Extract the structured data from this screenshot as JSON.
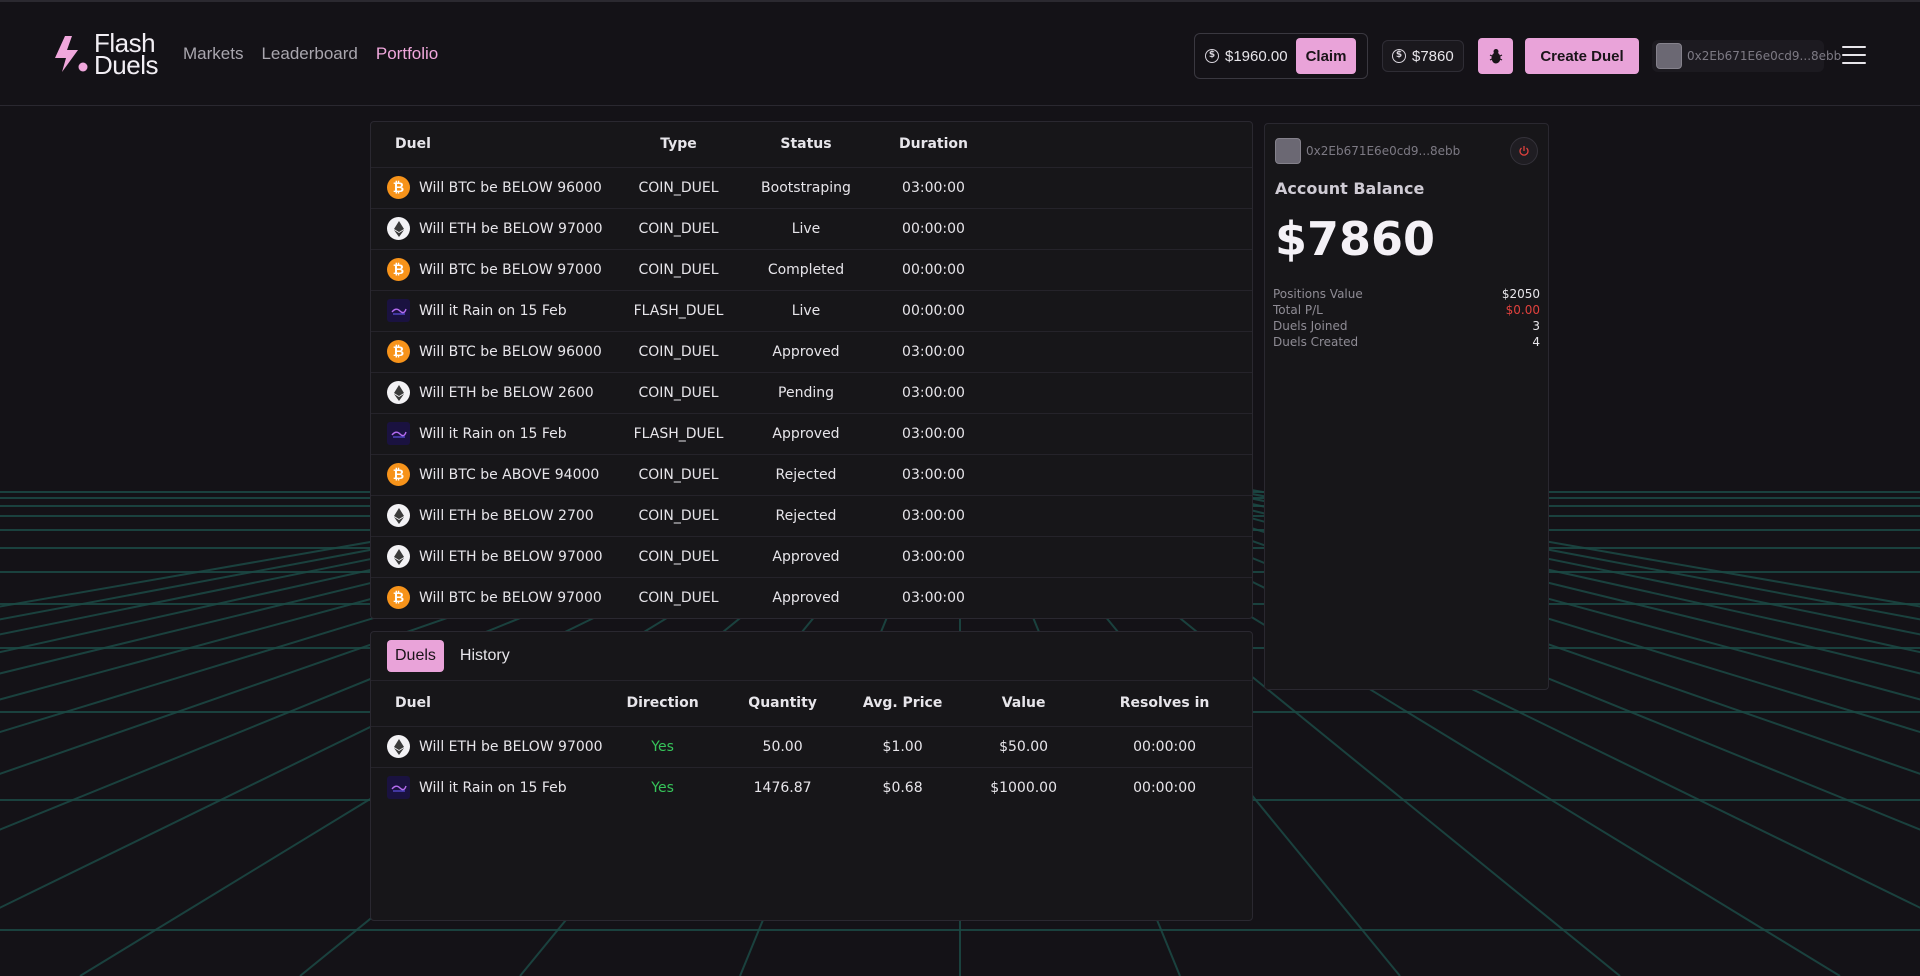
{
  "brand": {
    "line1": "Flash",
    "line2": "Duels"
  },
  "nav": [
    {
      "label": "Markets",
      "active": false
    },
    {
      "label": "Leaderboard",
      "active": false
    },
    {
      "label": "Portfolio",
      "active": true
    }
  ],
  "header": {
    "claimable_amount": "$1960.00",
    "claim_label": "Claim",
    "balance": "$7860",
    "create_duel_label": "Create Duel",
    "wallet_address": "0x2Eb671E6e0cd9...8ebb"
  },
  "duels_table": {
    "headers": [
      "Duel",
      "Type",
      "Status",
      "Duration"
    ],
    "rows": [
      {
        "icon": "btc",
        "title": "Will BTC be BELOW 96000",
        "type": "COIN_DUEL",
        "status": "Bootstraping",
        "duration": "03:00:00"
      },
      {
        "icon": "eth",
        "title": "Will ETH be BELOW 97000",
        "type": "COIN_DUEL",
        "status": "Live",
        "duration": "00:00:00"
      },
      {
        "icon": "btc",
        "title": "Will BTC be BELOW 97000",
        "type": "COIN_DUEL",
        "status": "Completed",
        "duration": "00:00:00"
      },
      {
        "icon": "rain",
        "title": "Will it Rain on 15 Feb",
        "type": "FLASH_DUEL",
        "status": "Live",
        "duration": "00:00:00"
      },
      {
        "icon": "btc",
        "title": "Will BTC be BELOW 96000",
        "type": "COIN_DUEL",
        "status": "Approved",
        "duration": "03:00:00"
      },
      {
        "icon": "eth",
        "title": "Will ETH be BELOW 2600",
        "type": "COIN_DUEL",
        "status": "Pending",
        "duration": "03:00:00"
      },
      {
        "icon": "rain",
        "title": "Will it Rain on 15 Feb",
        "type": "FLASH_DUEL",
        "status": "Approved",
        "duration": "03:00:00"
      },
      {
        "icon": "btc",
        "title": "Will BTC be ABOVE 94000",
        "type": "COIN_DUEL",
        "status": "Rejected",
        "duration": "03:00:00"
      },
      {
        "icon": "eth",
        "title": "Will ETH be BELOW 2700",
        "type": "COIN_DUEL",
        "status": "Rejected",
        "duration": "03:00:00"
      },
      {
        "icon": "eth",
        "title": "Will ETH be BELOW 97000",
        "type": "COIN_DUEL",
        "status": "Approved",
        "duration": "03:00:00"
      },
      {
        "icon": "btc",
        "title": "Will BTC be BELOW 97000",
        "type": "COIN_DUEL",
        "status": "Approved",
        "duration": "03:00:00"
      }
    ]
  },
  "positions": {
    "tabs": [
      {
        "label": "Duels",
        "active": true
      },
      {
        "label": "History",
        "active": false
      }
    ],
    "headers": [
      "Duel",
      "Direction",
      "Quantity",
      "Avg. Price",
      "Value",
      "Resolves in"
    ],
    "rows": [
      {
        "icon": "eth",
        "title": "Will ETH be BELOW 97000",
        "direction": "Yes",
        "quantity": "50.00",
        "avg_price": "$1.00",
        "value": "$50.00",
        "resolves_in": "00:00:00"
      },
      {
        "icon": "rain",
        "title": "Will it Rain on 15 Feb",
        "direction": "Yes",
        "quantity": "1476.87",
        "avg_price": "$0.68",
        "value": "$1000.00",
        "resolves_in": "00:00:00"
      }
    ]
  },
  "account": {
    "address": "0x2Eb671E6e0cd9...8ebb",
    "label": "Account Balance",
    "balance": "$7860",
    "stats": [
      {
        "label": "Positions Value",
        "value": "$2050",
        "negative": false
      },
      {
        "label": "Total P/L",
        "value": "$0.00",
        "negative": true
      },
      {
        "label": "Duels Joined",
        "value": "3",
        "negative": false
      },
      {
        "label": "Duels Created",
        "value": "4",
        "negative": false
      }
    ]
  },
  "colors": {
    "accent": "#e9a3d9",
    "background": "#141217",
    "grid": "#1c4a45",
    "positive": "#36c45a",
    "negative": "#e0413d",
    "btc": "#f7931a"
  }
}
